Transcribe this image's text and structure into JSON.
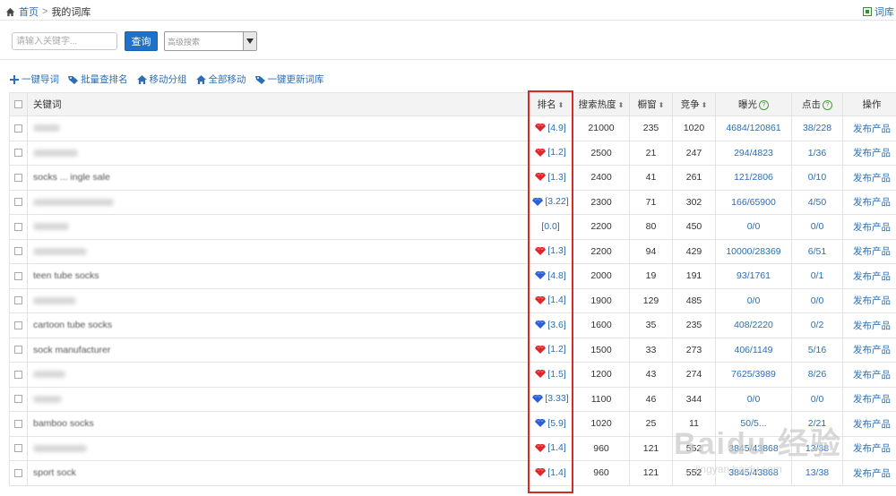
{
  "breadcrumb": {
    "home": "首页",
    "sep": ">",
    "current": "我的词库"
  },
  "topright_label": "词库",
  "search": {
    "placeholder": "请输入关键字...",
    "button": "查询",
    "advanced_placeholder": "高级搜索"
  },
  "actions": [
    {
      "label": "一键导词",
      "icon": "plus-icon"
    },
    {
      "label": "批量查排名",
      "icon": "tag-icon"
    },
    {
      "label": "移动分组",
      "icon": "house-icon"
    },
    {
      "label": "全部移动",
      "icon": "house-icon"
    },
    {
      "label": "一键更新词库",
      "icon": "tag-icon"
    }
  ],
  "table": {
    "headers": {
      "keyword": "关键词",
      "rank": "排名",
      "heat": "搜索热度",
      "window": "橱窗",
      "compete": "竞争",
      "exposure": "曝光",
      "clicks": "点击",
      "op": "操作"
    },
    "rows": [
      {
        "keyword": "",
        "blurw": 30,
        "gem": "red",
        "rank": "[4.9]",
        "heat": "21000",
        "window": "235",
        "compete": "1020",
        "exposure": "4684/120861",
        "clicks": "38/228",
        "op": "发布产品"
      },
      {
        "keyword": "",
        "blurw": 50,
        "gem": "red",
        "rank": "[1.2]",
        "heat": "2500",
        "window": "21",
        "compete": "247",
        "exposure": "294/4823",
        "clicks": "1/36",
        "op": "发布产品"
      },
      {
        "keyword": "socks ... ingle sale",
        "blurw": 0,
        "gem": "red",
        "rank": "[1.3]",
        "heat": "2400",
        "window": "41",
        "compete": "261",
        "exposure": "121/2806",
        "clicks": "0/10",
        "op": "发布产品"
      },
      {
        "keyword": "",
        "blurw": 90,
        "gem": "blue",
        "rank": "[3.22]",
        "heat": "2300",
        "window": "71",
        "compete": "302",
        "exposure": "166/65900",
        "clicks": "4/50",
        "op": "发布产品"
      },
      {
        "keyword": "",
        "blurw": 40,
        "gem": "",
        "rank": "[0.0]",
        "heat": "2200",
        "window": "80",
        "compete": "450",
        "exposure": "0/0",
        "clicks": "0/0",
        "op": "发布产品"
      },
      {
        "keyword": "",
        "blurw": 60,
        "gem": "red",
        "rank": "[1.3]",
        "heat": "2200",
        "window": "94",
        "compete": "429",
        "exposure": "10000/28369",
        "clicks": "6/51",
        "op": "发布产品"
      },
      {
        "keyword": "teen tube socks",
        "blurw": 0,
        "gem": "blue",
        "rank": "[4.8]",
        "heat": "2000",
        "window": "19",
        "compete": "191",
        "exposure": "93/1761",
        "clicks": "0/1",
        "op": "发布产品"
      },
      {
        "keyword": "",
        "blurw": 48,
        "gem": "red",
        "rank": "[1.4]",
        "heat": "1900",
        "window": "129",
        "compete": "485",
        "exposure": "0/0",
        "clicks": "0/0",
        "op": "发布产品"
      },
      {
        "keyword": "cartoon tube socks",
        "blurw": 0,
        "gem": "blue",
        "rank": "[3.6]",
        "heat": "1600",
        "window": "35",
        "compete": "235",
        "exposure": "408/2220",
        "clicks": "0/2",
        "op": "发布产品"
      },
      {
        "keyword": "sock manufacturer",
        "blurw": 0,
        "gem": "red",
        "rank": "[1.2]",
        "heat": "1500",
        "window": "33",
        "compete": "273",
        "exposure": "406/1149",
        "clicks": "5/16",
        "op": "发布产品"
      },
      {
        "keyword": "",
        "blurw": 36,
        "gem": "red",
        "rank": "[1.5]",
        "heat": "1200",
        "window": "43",
        "compete": "274",
        "exposure": "7625/3989",
        "clicks": "8/26",
        "op": "发布产品"
      },
      {
        "keyword": "",
        "blurw": 32,
        "gem": "blue",
        "rank": "[3.33]",
        "heat": "1100",
        "window": "46",
        "compete": "344",
        "exposure": "0/0",
        "clicks": "0/0",
        "op": "发布产品"
      },
      {
        "keyword": "bamboo socks",
        "blurw": 0,
        "gem": "blue",
        "rank": "[5.9]",
        "heat": "1020",
        "window": "25",
        "compete": "11",
        "exposure": "50/5...",
        "clicks": "2/21",
        "op": "发布产品"
      },
      {
        "keyword": "",
        "blurw": 60,
        "gem": "red",
        "rank": "[1.4]",
        "heat": "960",
        "window": "121",
        "compete": "552",
        "exposure": "3845/43868",
        "clicks": "13/38",
        "op": "发布产品"
      },
      {
        "keyword": "sport sock",
        "blurw": 0,
        "gem": "red",
        "rank": "[1.4]",
        "heat": "960",
        "window": "121",
        "compete": "552",
        "exposure": "3845/43868",
        "clicks": "13/38",
        "op": "发布产品"
      }
    ]
  },
  "watermark": {
    "main": "Baidu 经验",
    "sub": "jingyan.baidu.com"
  },
  "colors": {
    "link": "#2a6fb5",
    "query_button": "#1e72c8",
    "highlight": "#d42a2a",
    "gem_red": "#e0262a",
    "gem_blue": "#2a5fd8"
  }
}
